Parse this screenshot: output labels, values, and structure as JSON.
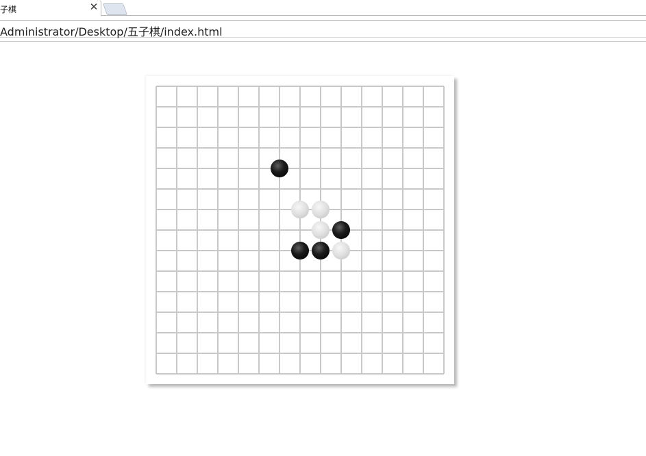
{
  "tab": {
    "title": "子棋",
    "close_glyph": "✕"
  },
  "address_bar": {
    "url": "Administrator/Desktop/五子棋/index.html"
  },
  "board": {
    "lines": 15,
    "line_color": "#c8c8c8",
    "background": "#ffffff",
    "stones": [
      {
        "col": 6,
        "row": 4,
        "color": "black"
      },
      {
        "col": 7,
        "row": 6,
        "color": "white"
      },
      {
        "col": 8,
        "row": 6,
        "color": "white"
      },
      {
        "col": 8,
        "row": 7,
        "color": "white"
      },
      {
        "col": 9,
        "row": 7,
        "color": "black"
      },
      {
        "col": 7,
        "row": 8,
        "color": "black"
      },
      {
        "col": 8,
        "row": 8,
        "color": "black"
      },
      {
        "col": 9,
        "row": 8,
        "color": "white"
      }
    ]
  },
  "colors": {
    "black_stone": "#1a1a1a",
    "white_stone": "#dcdcdc"
  }
}
